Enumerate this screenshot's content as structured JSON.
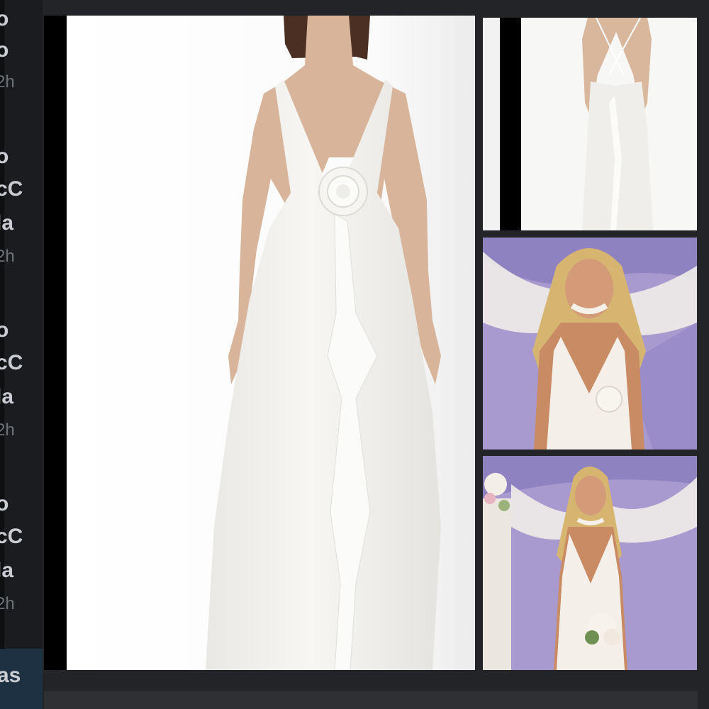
{
  "sidebar": {
    "entries": [
      {
        "line1": "o",
        "line2": "o",
        "line3": "",
        "time": "2h"
      },
      {
        "line1": "o",
        "line2": "cC",
        "line3": "la",
        "time": "2h"
      },
      {
        "line1": "o",
        "line2": "cC",
        "line3": "la",
        "time": "2h"
      },
      {
        "line1": "o",
        "line2": "cC",
        "line3": "la",
        "time": "2h"
      }
    ],
    "bottom": "as"
  },
  "post": {
    "images": [
      {
        "name": "product-photo-front",
        "icon": "white-gown-front"
      },
      {
        "name": "product-photo-back",
        "icon": "white-gown-back"
      },
      {
        "name": "bride-photo-closeup",
        "icon": "bride-closeup"
      },
      {
        "name": "bride-photo-full",
        "icon": "bride-full"
      }
    ]
  },
  "colors": {
    "background": "#232427",
    "sidebar": "#1b1c1f",
    "lavender_drape": "#b6a8d6",
    "gown": "#f4f3f0"
  }
}
